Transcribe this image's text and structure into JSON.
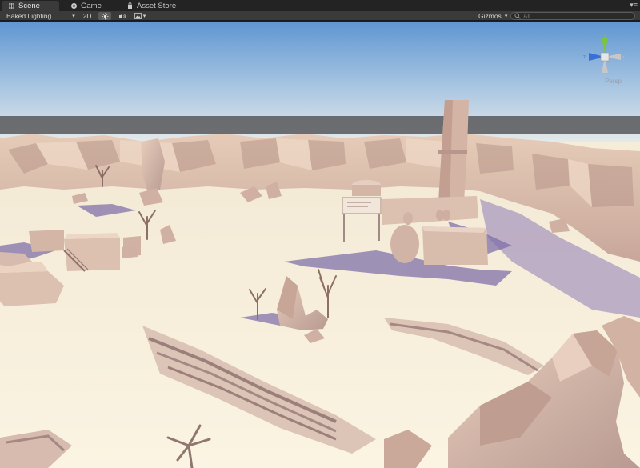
{
  "tabs": [
    {
      "label": "Scene",
      "icon": "scene-icon",
      "active": true
    },
    {
      "label": "Game",
      "icon": "game-icon",
      "active": false
    },
    {
      "label": "Asset Store",
      "icon": "store-icon",
      "active": false
    }
  ],
  "tab_menu": "▾≡",
  "toolbar": {
    "render_mode": "Baked Lighting",
    "mode_2d": "2D",
    "gizmos": "Gizmos",
    "search_placeholder": "All"
  },
  "gizmo": {
    "y": "y",
    "x": "x",
    "z": "z",
    "projection": "Persp"
  },
  "colors": {
    "sky_top": "#5f96d2",
    "sky_bottom": "#dfe6ea",
    "ground": "#f7eed8",
    "rock": "#dcc0b0",
    "shadow": "#7d6da8",
    "axis_y": "#7cc43a",
    "axis_x": "#d9473b",
    "axis_z": "#3a6fd8"
  }
}
